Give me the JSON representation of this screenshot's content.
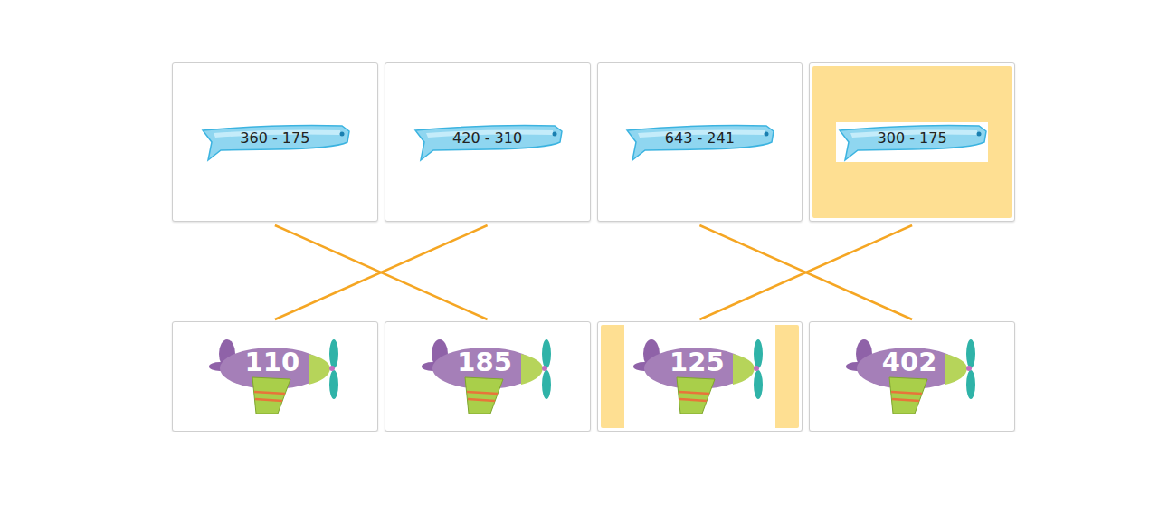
{
  "expressions": [
    {
      "label": "360 - 175",
      "selected": false
    },
    {
      "label": "420 - 310",
      "selected": false
    },
    {
      "label": "643 - 241",
      "selected": false
    },
    {
      "label": "300 - 175",
      "selected": true
    }
  ],
  "answers": [
    {
      "label": "110",
      "selected": false
    },
    {
      "label": "185",
      "selected": false
    },
    {
      "label": "125",
      "selected": true
    },
    {
      "label": "402",
      "selected": false
    }
  ],
  "connections": [
    {
      "from": 0,
      "to": 1
    },
    {
      "from": 1,
      "to": 0
    },
    {
      "from": 2,
      "to": 3
    },
    {
      "from": 3,
      "to": 2
    }
  ]
}
